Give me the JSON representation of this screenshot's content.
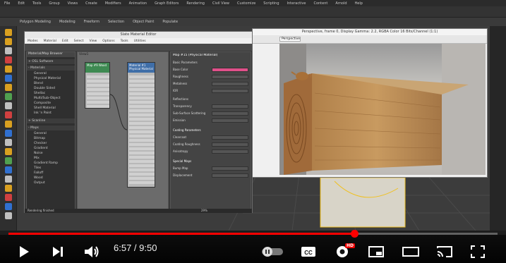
{
  "app": {
    "menu": [
      "File",
      "Edit",
      "Tools",
      "Group",
      "Views",
      "Create",
      "Modifiers",
      "Animation",
      "Graph Editors",
      "Rendering",
      "Civil View",
      "Customize",
      "Scripting",
      "Interactive",
      "Content",
      "Arnold",
      "Help"
    ],
    "ribbon_tabs": [
      "Modeling",
      "Freeform",
      "Selection",
      "Object Paint",
      "Populate"
    ],
    "ribbon_sub": "Polygon Modeling",
    "workspace": "Workspaces: Default"
  },
  "slate": {
    "title": "Slate Material Editor",
    "menu": [
      "Modes",
      "Material",
      "Edit",
      "Select",
      "View",
      "Options",
      "Tools",
      "Utilities"
    ],
    "browser_header": "Material/Map Browser",
    "browser_sections": [
      {
        "label": "+ OSL Software",
        "items": []
      },
      {
        "label": "- Materials",
        "items": [
          "General",
          "Physical Material",
          "Blend",
          "Double Sided",
          "Shellac",
          "Multi/Sub-Object",
          "Composite",
          "Shell Material",
          "Ink 'n Paint"
        ]
      },
      {
        "label": "+ Scanline",
        "items": []
      },
      {
        "label": "- Maps",
        "items": [
          "General",
          "Bitmap",
          "Checker",
          "Gradient",
          "Noise",
          "Mix",
          "Gradient Ramp",
          "Tiles",
          "Falloff",
          "Wood",
          "Output"
        ]
      }
    ],
    "view_label": "View1",
    "node1": {
      "title": "Map #9 Wood"
    },
    "node2": {
      "title": "Material #1 Physical Material"
    },
    "props_title": "Map #15 (Physical Material)",
    "props": [
      {
        "label": "Basic Parameters",
        "value": ""
      },
      {
        "label": "Base Color",
        "value": "1.0"
      },
      {
        "label": "Roughness",
        "value": "0.0"
      },
      {
        "label": "Metalness",
        "value": "0.0"
      },
      {
        "label": "IOR",
        "value": "1.52"
      },
      {
        "label": "Reflections",
        "value": ""
      },
      {
        "label": "Transparency",
        "value": "0.0"
      },
      {
        "label": "Sub-Surface Scattering",
        "value": "0.0"
      },
      {
        "label": "Emission",
        "value": "0.0"
      },
      {
        "label": "Coating Parameters",
        "value": ""
      },
      {
        "label": "Clearcoat",
        "value": "0.0"
      },
      {
        "label": "Coating Roughness",
        "value": "0.0"
      },
      {
        "label": "Anisotropy",
        "value": "0.0"
      },
      {
        "label": "Special Maps",
        "value": ""
      },
      {
        "label": "Bump Map",
        "value": "0.3"
      },
      {
        "label": "Displacement",
        "value": "1.0"
      }
    ],
    "status": "Rendering finished",
    "zoom": "29%"
  },
  "render": {
    "title": "Perspective, frame 0, Display Gamma: 2.2, RGBA Color 16 Bits/Channel (1:1)",
    "view": "Perspective"
  },
  "player": {
    "time_current": "6:57",
    "time_total": "9:50",
    "time_text": "6:57 / 9:50",
    "progress": 0.707,
    "hd_badge": "HD",
    "colors": {
      "progress": "#ff0000",
      "badge": "#e00000"
    }
  }
}
